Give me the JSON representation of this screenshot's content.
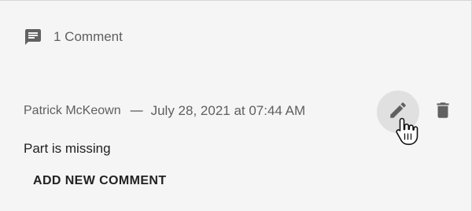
{
  "comments_header": {
    "icon": "comment-icon",
    "count_label": "1 Comment"
  },
  "comment": {
    "author": "Patrick McKeown",
    "separator": "—",
    "timestamp": "July 28, 2021 at 07:44 AM",
    "text": "Part is missing",
    "actions": {
      "edit_icon": "pencil-icon",
      "delete_icon": "trash-icon"
    }
  },
  "add_comment": {
    "label": "ADD NEW COMMENT"
  },
  "colors": {
    "panel_background": "#f5f5f5",
    "icon_gray": "#616161",
    "hover_circle": "#e0e0e0",
    "secondary_text": "#5f5f5f"
  }
}
